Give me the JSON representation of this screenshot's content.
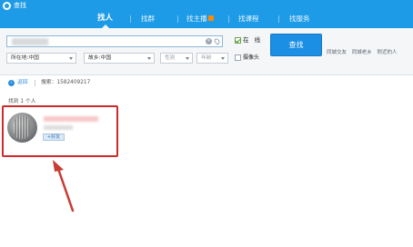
{
  "app": {
    "title": "查找"
  },
  "nav": {
    "tabs": [
      {
        "label": "找人",
        "active": true
      },
      {
        "label": "找群",
        "active": false
      },
      {
        "label": "找主播",
        "active": false,
        "badge": "live-badge"
      },
      {
        "label": "找课程",
        "active": false
      },
      {
        "label": "找服务",
        "active": false
      }
    ]
  },
  "filters": {
    "online_label": "在 线",
    "camera_label": "摄像头",
    "location": "所在地:中国",
    "hometown": "故乡:中国",
    "gender": "性别",
    "age": "年龄",
    "search_button": "查找",
    "quick_links": [
      "同城交友",
      "同城老乡",
      "附近的人"
    ]
  },
  "results": {
    "back_label": "返回",
    "query_text": "搜索：1582409217",
    "count_text": "找到 1 个人",
    "items": [
      {
        "name": "",
        "id_text": "",
        "add_friend_label": "+好友"
      }
    ]
  },
  "colors": {
    "brand_blue": "#1e9be6",
    "button_blue": "#1b8fe4",
    "highlight_red": "#cf2a2a",
    "online_green": "#3f8f1f"
  },
  "icons": {
    "logo": "app-logo-icon",
    "clear": "clear-icon",
    "location": "location-pin-icon",
    "back": "back-arrow-icon",
    "annotation": "red-arrow-icon"
  }
}
